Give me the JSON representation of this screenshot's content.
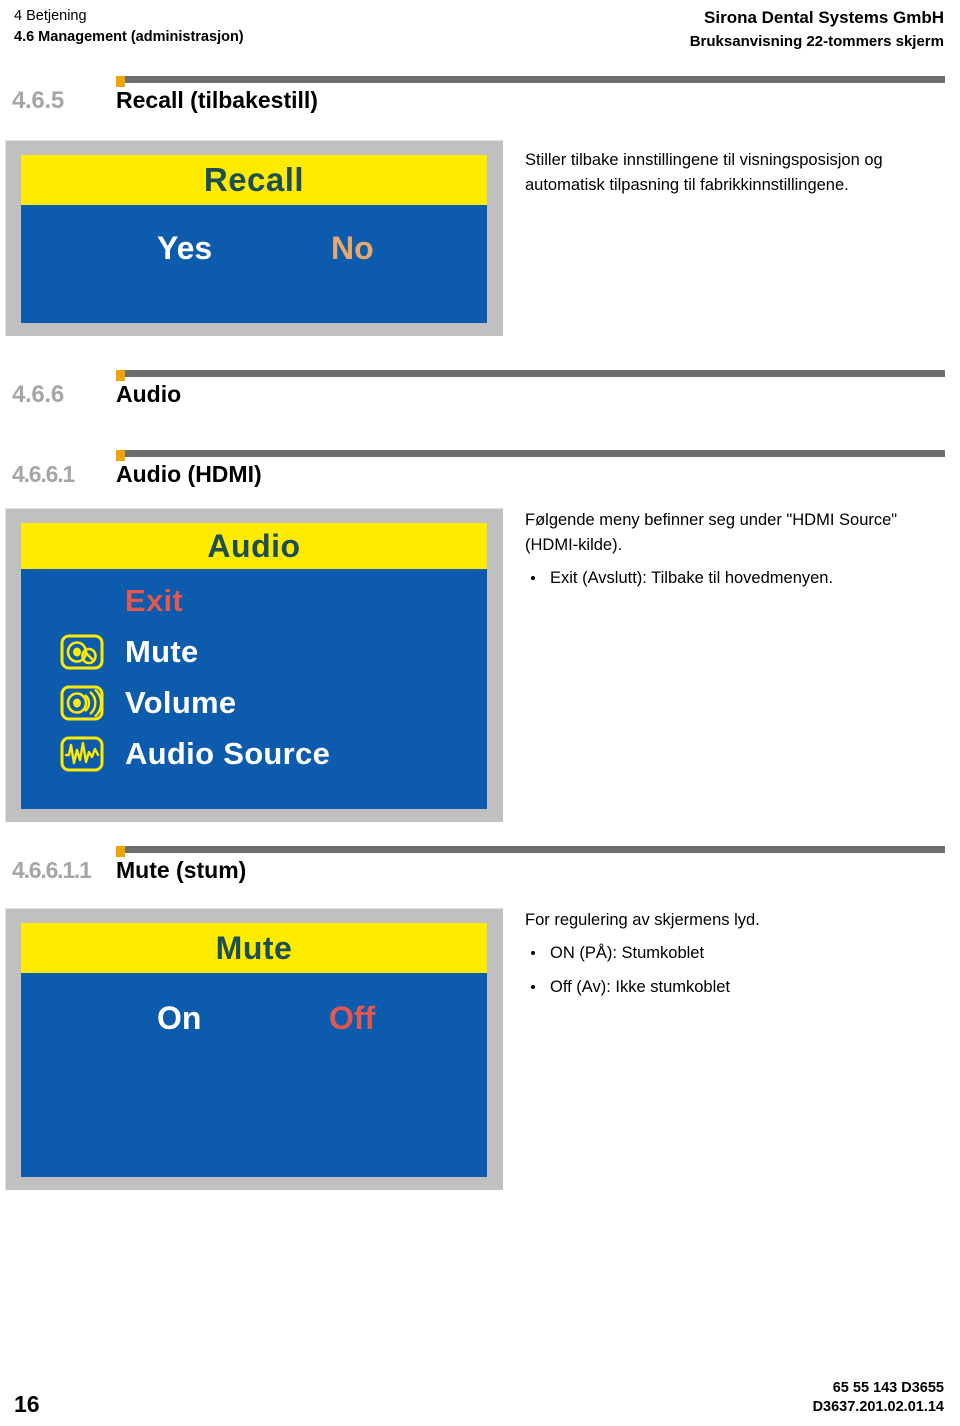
{
  "header": {
    "left_line1": "4 Betjening",
    "left_line2": "4.6 Management (administrasjon)",
    "right_line1": "Sirona Dental Systems GmbH",
    "right_line2": "Bruksanvisning 22-tommers skjerm"
  },
  "sections": [
    {
      "number": "4.6.5",
      "title": "Recall (tilbakestill)",
      "screenshot": {
        "title": "Recall",
        "choices": [
          {
            "label": "Yes",
            "color": "#ffffff"
          },
          {
            "label": "No",
            "color": "#e8a76b"
          }
        ]
      },
      "text": {
        "paragraph": "Stiller tilbake innstillingene til visningsposisjon og automatisk tilpasning til fabrikkinnstillingene."
      }
    },
    {
      "number": "4.6.6",
      "title": "Audio"
    },
    {
      "number": "4.6.6.1",
      "title": "Audio (HDMI)",
      "screenshot": {
        "title": "Audio",
        "items": [
          {
            "label": "Exit",
            "icon": "none",
            "color": "#e4574d"
          },
          {
            "label": "Mute",
            "icon": "mute-icon",
            "color": "#ffffff"
          },
          {
            "label": "Volume",
            "icon": "volume-icon",
            "color": "#ffffff"
          },
          {
            "label": "Audio Source",
            "icon": "waveform-icon",
            "color": "#ffffff"
          }
        ]
      },
      "text": {
        "paragraph": "Følgende meny befinner seg under \"HDMI Source\" (HDMI-kilde).",
        "bullets": [
          "Exit (Avslutt): Tilbake til hovedmenyen."
        ]
      }
    },
    {
      "number": "4.6.6.1.1",
      "title": "Mute (stum)",
      "screenshot": {
        "title": "Mute",
        "choices": [
          {
            "label": "On",
            "color": "#ffffff"
          },
          {
            "label": "Off",
            "color": "#e4574d"
          }
        ]
      },
      "text": {
        "paragraph": "For regulering av skjermens lyd.",
        "bullets": [
          "ON (PÅ): Stumkoblet",
          "Off (Av): Ikke stumkoblet"
        ]
      }
    }
  ],
  "footer": {
    "page_number": "16",
    "right_line1": "65 55 143 D3655",
    "right_line2": "D3637.201.02.01.14"
  },
  "colors": {
    "osd_blue": "#0c5bad",
    "osd_yellow": "#ffeb00",
    "osd_title_text": "#1d4f52",
    "frame_gray": "#c0c0c0",
    "rule_gray": "#6e6e6e",
    "marker_orange": "#f0a500",
    "section_number_gray": "#a6a6a6"
  }
}
